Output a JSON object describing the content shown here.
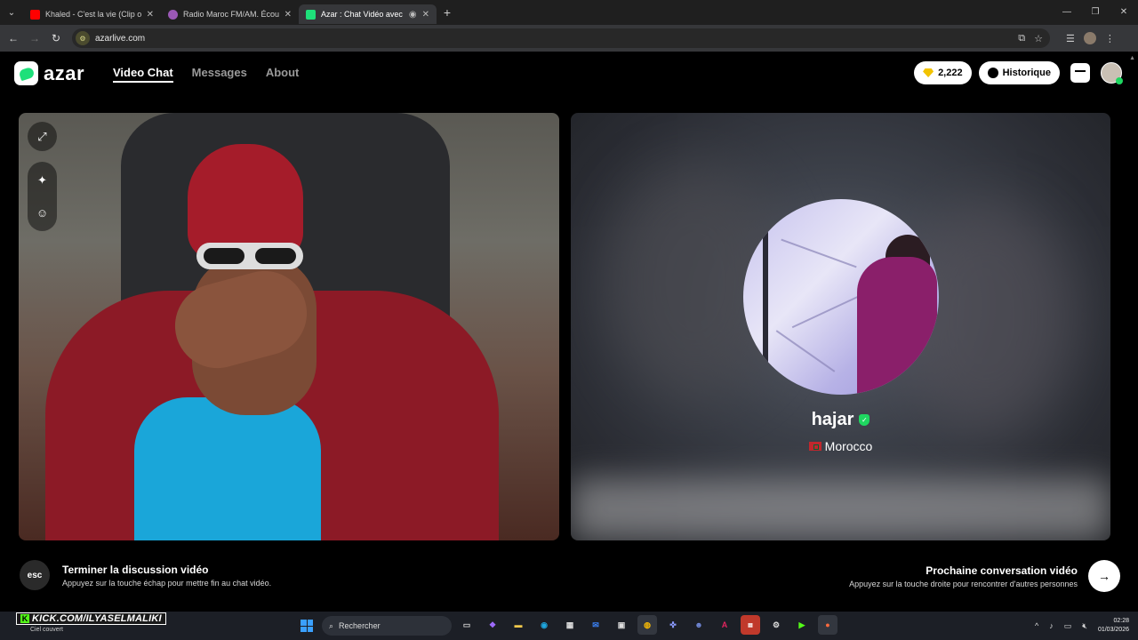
{
  "browser": {
    "tabs": [
      {
        "title": "Khaled - C'est la vie (Clip officiel)",
        "favicon_color": "#ff0000",
        "active": false
      },
      {
        "title": "Radio Maroc FM/AM. Écouter radio",
        "favicon_color": "#9b59b6",
        "active": false
      },
      {
        "title": "Azar : Chat Vidéo avec de nouvelles personnes",
        "favicon_color": "#1ee07a",
        "active": true
      }
    ],
    "url": "azarlive.com"
  },
  "header": {
    "logo_text": "azar",
    "nav": [
      {
        "label": "Video Chat",
        "active": true
      },
      {
        "label": "Messages",
        "active": false
      },
      {
        "label": "About",
        "active": false
      }
    ],
    "gems": "2,222",
    "history_label": "Historique"
  },
  "peer": {
    "name": "hajar",
    "country": "Morocco"
  },
  "bottom": {
    "esc_key": "esc",
    "end_title": "Terminer la discussion vidéo",
    "end_sub": "Appuyez sur la touche échap pour mettre fin au chat vidéo.",
    "next_title": "Prochaine conversation vidéo",
    "next_sub": "Appuyez sur la touche droite pour rencontrer d'autres personnes"
  },
  "taskbar": {
    "overlay_text": "KICK.COM/ILYASELMALIKI",
    "weather": "Ciel couvert",
    "search_placeholder": "Rechercher",
    "time": "02:28",
    "date": "01/03/2026"
  },
  "colors": {
    "accent": "#1ee07a",
    "gem": "#f2c300"
  }
}
